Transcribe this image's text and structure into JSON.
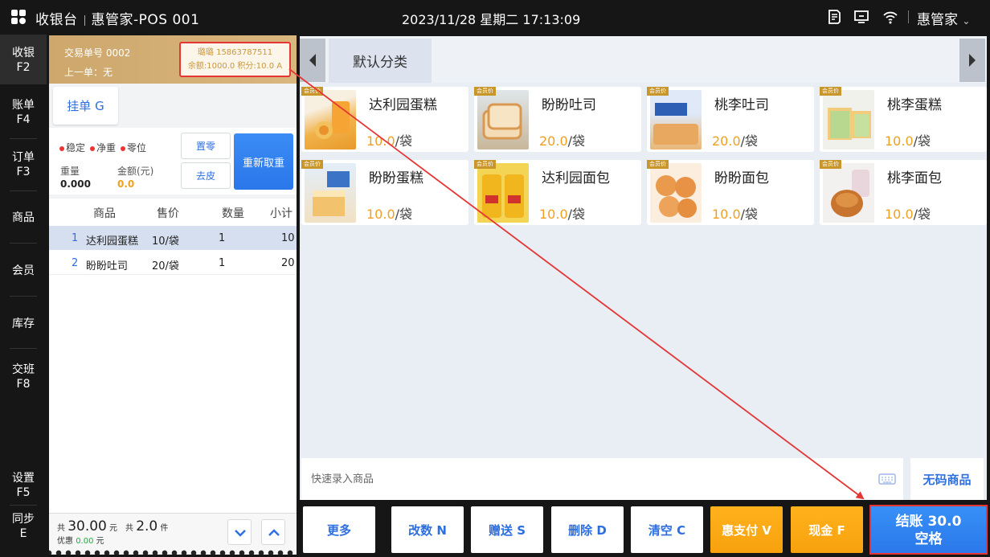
{
  "topbar": {
    "app_name": "收银台",
    "store_pos": "惠管家-POS 001",
    "datetime": "2023/11/28 星期二 17:13:09",
    "user": "惠管家"
  },
  "nav": [
    {
      "label": "收银",
      "key": "F2"
    },
    {
      "label": "账单",
      "key": "F4"
    },
    {
      "label": "订单",
      "key": "F3"
    },
    {
      "label": "商品",
      "key": ""
    },
    {
      "label": "会员",
      "key": ""
    },
    {
      "label": "库存",
      "key": ""
    },
    {
      "label": "交班",
      "key": "F8"
    },
    {
      "label": "设置",
      "key": "F5"
    },
    {
      "label": "同步",
      "key": "E"
    }
  ],
  "transaction": {
    "order_no": "交易单号 0002",
    "last_order": "上一单：无",
    "member_line1": "璐璐 15863787511",
    "member_line2": "余额:1000.0 积分:10.0 A"
  },
  "hang_button": "挂单 G",
  "scale": {
    "status": [
      "稳定",
      "净重",
      "零位"
    ],
    "weight_label": "重量",
    "weight_value": "0.000",
    "amount_label": "金额(元)",
    "amount_value": "0.0",
    "zero_button": "置零",
    "tare_button": "去皮",
    "retare_button": "重新取重"
  },
  "cart": {
    "columns": [
      "商品",
      "售价",
      "数量",
      "小计"
    ],
    "rows": [
      {
        "idx": "1",
        "name": "达利园蛋糕",
        "price": "10/袋",
        "qty": "1",
        "subtotal": "10"
      },
      {
        "idx": "2",
        "name": "盼盼吐司",
        "price": "20/袋",
        "qty": "1",
        "subtotal": "20"
      }
    ]
  },
  "footer": {
    "total_prefix": "共",
    "total_amount": "30.00",
    "total_unit": "元",
    "count_prefix": "共",
    "count": "2.0",
    "count_unit": "件",
    "discount_label": "优惠",
    "discount_value": "0.00",
    "discount_unit": "元"
  },
  "category_tab": "默认分类",
  "member_price_tag": "会员价",
  "products": [
    {
      "name": "达利园蛋糕",
      "price": "10.0",
      "unit": "/袋"
    },
    {
      "name": "盼盼吐司",
      "price": "20.0",
      "unit": "/袋"
    },
    {
      "name": "桃李吐司",
      "price": "20.0",
      "unit": "/袋"
    },
    {
      "name": "桃李蛋糕",
      "price": "10.0",
      "unit": "/袋"
    },
    {
      "name": "盼盼蛋糕",
      "price": "10.0",
      "unit": "/袋"
    },
    {
      "name": "达利园面包",
      "price": "10.0",
      "unit": "/袋"
    },
    {
      "name": "盼盼面包",
      "price": "10.0",
      "unit": "/袋"
    },
    {
      "name": "桃李面包",
      "price": "10.0",
      "unit": "/袋"
    }
  ],
  "quick_entry_placeholder": "快速录入商品",
  "no_code_button": "无码商品",
  "actions": {
    "more": "更多",
    "change_qty": "改数 N",
    "gift": "赠送 S",
    "delete": "删除 D",
    "clear": "清空 C",
    "huipay": "惠支付 V",
    "cash": "现金 F",
    "checkout_line1": "结账 30.0",
    "checkout_line2": "空格"
  },
  "colors": {
    "accent_blue": "#2e6fe0",
    "highlight_red": "#e53535",
    "price_orange": "#f0a020",
    "member_gold": "#c9962c"
  }
}
